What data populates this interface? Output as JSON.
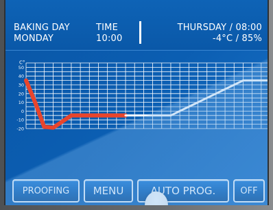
{
  "header": {
    "day_label": "BAKING DAY",
    "day_value": "MONDAY",
    "time_label": "TIME",
    "time_value": "10:00",
    "date_time": "THURSDAY / 08:00",
    "climate": "-4°C / 85%"
  },
  "chart_data": {
    "type": "line",
    "ylabel": "C°",
    "y_ticks": [
      "50",
      "40",
      "30",
      "20",
      "10",
      "0",
      "-10",
      "-20"
    ],
    "ylim": [
      -20,
      55
    ],
    "grid": true,
    "series": [
      {
        "segment": "elapsed",
        "color": "#e8452c",
        "points": [
          [
            0,
            35
          ],
          [
            1,
            10
          ],
          [
            2,
            -18
          ],
          [
            3,
            -19
          ],
          [
            4,
            -12
          ],
          [
            5,
            -5
          ],
          [
            6,
            -5
          ],
          [
            7,
            -5
          ],
          [
            8,
            -5
          ],
          [
            9,
            -5
          ],
          [
            10,
            -5
          ],
          [
            11,
            -5
          ]
        ]
      },
      {
        "segment": "remaining",
        "color": "#ffffff",
        "points": [
          [
            11,
            -5
          ],
          [
            12,
            -5
          ],
          [
            13,
            -5
          ],
          [
            14,
            -5
          ],
          [
            15,
            -5
          ],
          [
            16,
            -5
          ],
          [
            17,
            0
          ],
          [
            18,
            5
          ],
          [
            19,
            10
          ],
          [
            20,
            15
          ],
          [
            21,
            20
          ],
          [
            22,
            25
          ],
          [
            23,
            30
          ],
          [
            24,
            35
          ],
          [
            25,
            35
          ],
          [
            26,
            35
          ],
          [
            27,
            35
          ]
        ]
      }
    ]
  },
  "buttons": {
    "proofing": "PROOFING",
    "menu": "MENU",
    "auto_prog": "AUTO PROG.",
    "off": "OFF"
  },
  "colors": {
    "screen_blue": "#0b5eb2",
    "elapsed_line": "#e8452c",
    "remaining_line": "#ffffff",
    "grid": "#ffffff"
  }
}
